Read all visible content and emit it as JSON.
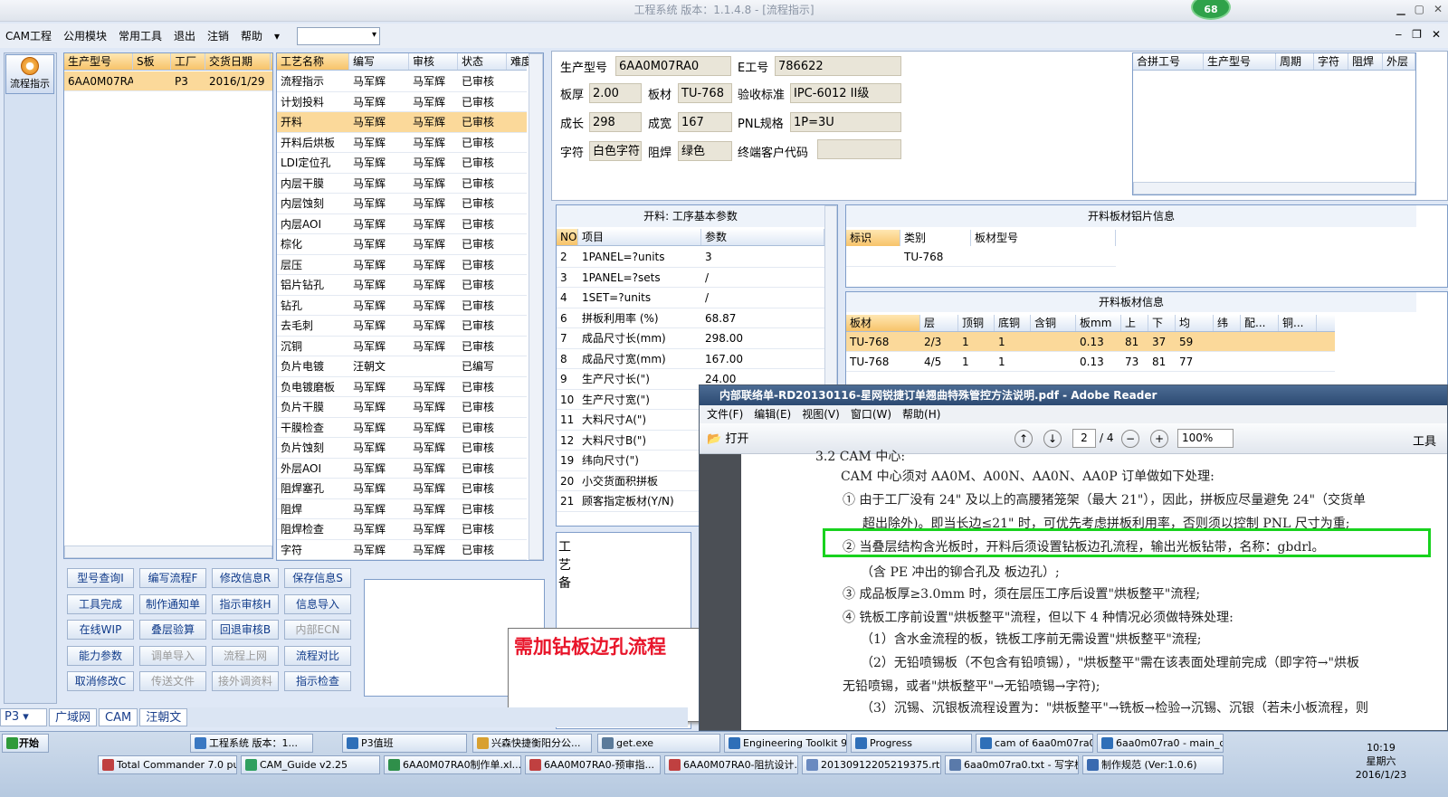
{
  "window": {
    "title": "工程系统  版本：1.1.4.8 - [流程指示]",
    "badge": "68"
  },
  "menu": {
    "items": [
      "CAM工程",
      "公用模块",
      "常用工具",
      "退出",
      "注销",
      "帮助"
    ],
    "help_arrow": "▾"
  },
  "leftnav": {
    "flow_button": "流程指示"
  },
  "model_grid": {
    "headers": [
      "生产型号",
      "S板",
      "工厂",
      "交货日期"
    ],
    "rows": [
      [
        "6AA0M07RA0",
        "",
        "P3",
        "2016/1/29"
      ]
    ]
  },
  "process_grid": {
    "headers": [
      "工艺名称",
      "编写",
      "审核",
      "状态",
      "难度"
    ],
    "rows": [
      [
        "流程指示",
        "马军辉",
        "马军辉",
        "已审核",
        ""
      ],
      [
        "计划投料",
        "马军辉",
        "马军辉",
        "已审核",
        ""
      ],
      [
        "开料",
        "马军辉",
        "马军辉",
        "已审核",
        ""
      ],
      [
        "开料后烘板",
        "马军辉",
        "马军辉",
        "已审核",
        ""
      ],
      [
        "LDI定位孔",
        "马军辉",
        "马军辉",
        "已审核",
        ""
      ],
      [
        "内层干膜",
        "马军辉",
        "马军辉",
        "已审核",
        ""
      ],
      [
        "内层蚀刻",
        "马军辉",
        "马军辉",
        "已审核",
        ""
      ],
      [
        "内层AOI",
        "马军辉",
        "马军辉",
        "已审核",
        ""
      ],
      [
        "棕化",
        "马军辉",
        "马军辉",
        "已审核",
        ""
      ],
      [
        "层压",
        "马军辉",
        "马军辉",
        "已审核",
        ""
      ],
      [
        "铝片钻孔",
        "马军辉",
        "马军辉",
        "已审核",
        ""
      ],
      [
        "钻孔",
        "马军辉",
        "马军辉",
        "已审核",
        ""
      ],
      [
        "去毛刺",
        "马军辉",
        "马军辉",
        "已审核",
        ""
      ],
      [
        "沉铜",
        "马军辉",
        "马军辉",
        "已审核",
        ""
      ],
      [
        "负片电镀",
        "汪朝文",
        "",
        "已编写",
        ""
      ],
      [
        "负电镀磨板",
        "马军辉",
        "马军辉",
        "已审核",
        ""
      ],
      [
        "负片干膜",
        "马军辉",
        "马军辉",
        "已审核",
        ""
      ],
      [
        "干膜检查",
        "马军辉",
        "马军辉",
        "已审核",
        ""
      ],
      [
        "负片蚀刻",
        "马军辉",
        "马军辉",
        "已审核",
        ""
      ],
      [
        "外层AOI",
        "马军辉",
        "马军辉",
        "已审核",
        ""
      ],
      [
        "阻焊塞孔",
        "马军辉",
        "马军辉",
        "已审核",
        ""
      ],
      [
        "阻焊",
        "马军辉",
        "马军辉",
        "已审核",
        ""
      ],
      [
        "阻焊检查",
        "马军辉",
        "马军辉",
        "已审核",
        ""
      ],
      [
        "字符",
        "马军辉",
        "马军辉",
        "已审核",
        ""
      ]
    ]
  },
  "info": {
    "model_label": "生产型号",
    "model": "6AA0M07RA0",
    "eno_label": "E工号",
    "eno": "786622",
    "thick_label": "板厚",
    "thick": "2.00",
    "mat_label": "板材",
    "mat": "TU-768",
    "std_label": "验收标准",
    "std": "IPC-6012 II级",
    "len_label": "成长",
    "len": "298",
    "wid_label": "成宽",
    "wid": "167",
    "pnl_label": "PNL规格",
    "pnl": "1P=3U",
    "char_label": "字符",
    "char": "白色字符",
    "mask_label": "阻焊",
    "mask": "绿色",
    "cust_label": "终端客户代码",
    "cust": ""
  },
  "merge_grid": {
    "headers": [
      "合拼工号",
      "生产型号",
      "周期",
      "字符",
      "阻焊",
      "外层"
    ]
  },
  "params": {
    "title": "开料: 工序基本参数",
    "headers": [
      "NO",
      "项目",
      "参数"
    ],
    "rows": [
      [
        "2",
        "1PANEL=?units",
        "3"
      ],
      [
        "3",
        "1PANEL=?sets",
        "/"
      ],
      [
        "4",
        "1SET=?units",
        "/"
      ],
      [
        "6",
        "拼板利用率 (%)",
        "68.87"
      ],
      [
        "7",
        "成品尺寸长(mm)",
        "298.00"
      ],
      [
        "8",
        "成品尺寸宽(mm)",
        "167.00"
      ],
      [
        "9",
        "生产尺寸长(\")",
        "24.00"
      ],
      [
        "10",
        "生产尺寸宽(\")",
        "20.00"
      ],
      [
        "11",
        "大料尺寸A(\")",
        "48.00"
      ],
      [
        "12",
        "大料尺寸B(\")",
        "40.00"
      ],
      [
        "19",
        "纬向尺寸(\")",
        ""
      ],
      [
        "20",
        "小交货面积拼板",
        ""
      ],
      [
        "21",
        "顾客指定板材(Y/N)",
        ""
      ]
    ]
  },
  "alu": {
    "title": "开料板材铝片信息",
    "headers": [
      "标识",
      "类别",
      "板材型号"
    ],
    "rows": [
      [
        "",
        "TU-768",
        ""
      ]
    ]
  },
  "boardinfo": {
    "title": "开料板材信息",
    "headers": [
      "板材",
      "层",
      "顶铜",
      "底铜",
      "含铜mm",
      "板mm",
      "上",
      "下",
      "均",
      "纬",
      "配...",
      "铜..."
    ],
    "rows": [
      [
        "TU-768",
        "2/3",
        "1",
        "1",
        "",
        "0.13",
        "81",
        "37",
        "59",
        "",
        "",
        ""
      ],
      [
        "TU-768",
        "4/5",
        "1",
        "1",
        "",
        "0.13",
        "73",
        "81",
        "77",
        "",
        "",
        ""
      ]
    ]
  },
  "craft_label": "工艺备",
  "buttons": [
    [
      "型号查询I",
      "编写流程F",
      "修改信息R",
      "保存信息S"
    ],
    [
      "工具完成",
      "制作通知单",
      "指示审核H",
      "信息导入"
    ],
    [
      "在线WIP",
      "叠层验算",
      "回退审核B",
      "内部ECN"
    ],
    [
      "能力参数",
      "调单导入",
      "流程上网",
      "流程对比"
    ],
    [
      "取消修改C",
      "传送文件",
      "接外调资料",
      "指示检查"
    ]
  ],
  "disabled_buttons": [
    "内部ECN",
    "调单导入",
    "流程上网",
    "传送文件",
    "接外调资料"
  ],
  "note": "需加钻板边孔流程",
  "bottom": {
    "factory": "P3",
    "tabs": [
      "广域网",
      "CAM",
      "汪朝文"
    ]
  },
  "adobe": {
    "title": "内部联络单-RD20130116-星网锐捷订单翘曲特殊管控方法说明.pdf - Adobe Reader",
    "menu": [
      "文件(F)",
      "编辑(E)",
      "视图(V)",
      "窗口(W)",
      "帮助(H)"
    ],
    "open": "打开",
    "page": "2",
    "pages": "/ 4",
    "zoom": "100%",
    "tools": "工具",
    "lines": [
      "3.2 CAM 中心:",
      "CAM 中心须对 AA0M、A00N、AA0N、AA0P 订单做如下处理:",
      "① 由于工厂没有 24\" 及以上的高腰猪笼架（最大 21\"），因此，拼板应尽量避免 24\"（交货单",
      "超出除外)。即当长边≤21\" 时，可优先考虑拼板利用率，否则须以控制 PNL 尺寸为重;",
      "② 当叠层结构含光板时，开料后须设置钻板边孔流程，输出光板钻带，名称：gbdrl。",
      "（含 PE 冲出的铆合孔及                    板边孔）;",
      "③ 成品板厚≥3.0mm 时，须在层压工序后设置\"烘板整平\"流程;",
      "④ 铣板工序前设置\"烘板整平\"流程，但以下 4 种情况必须做特殊处理:",
      "（1）含水金流程的板，铣板工序前无需设置\"烘板整平\"流程;",
      "（2）无铅喷锡板（不包含有铅喷锡），\"烘板整平\"需在该表面处理前完成（即字符→\"烘板",
      "无铅喷锡，或者\"烘板整平\"→无铅喷锡→字符);",
      "（3）沉锡、沉银板流程设置为：\"烘板整平\"→铣板→检验→沉锡、沉银（若未小板流程，则"
    ]
  },
  "taskbar": {
    "start": "开始",
    "row1": [
      "工程系统  版本：1...",
      "P3值班",
      "兴森快捷衡阳分公...",
      "get.exe",
      "Engineering Toolkit 9...",
      "Progress",
      "cam of 6aa0m07ra0",
      "6aa0m07ra0 - main_qa"
    ],
    "row2": [
      "Total Commander 7.0 pu...",
      "CAM_Guide v2.25",
      "6AA0M07RA0制作单.xl...",
      "6AA0M07RA0-预审指...",
      "6AA0M07RA0-阻抗设计...",
      "20130912205219375.rt...",
      "6aa0m07ra0.txt - 写字板",
      "制作规范 (Ver:1.0.6)"
    ],
    "time": "10:19",
    "day": "星期六",
    "date": "2016/1/23"
  }
}
